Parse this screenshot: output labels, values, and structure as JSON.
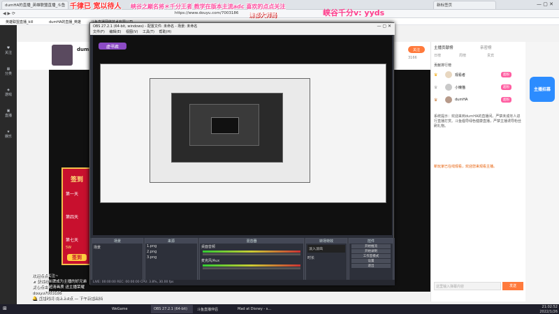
{
  "browser": {
    "tabs": [
      {
        "label": "dumHA的直播_英雄联盟直播_斗鱼"
      },
      {
        "label": "新标签页"
      }
    ],
    "bookmarks": [
      "英雄联盟直播_kill",
      "dumHA的直播_英雄",
      "斗鱼直播网络技术有限公司"
    ],
    "url": "https://www.douyu.com/7003186"
  },
  "overlay": {
    "banner_left": "千律已  宽以待人",
    "banner_mid": "峡谷之巅名将＊千分王者  教学在版本主流adc  喜欢的点点关注",
    "banner_right": "峡谷千分v: yyds",
    "subtitle": "清都大师局"
  },
  "site_nav": [
    "关注",
    "分类",
    "游戏",
    "直播",
    "娱乐"
  ],
  "room": {
    "anchor_name": "dumHA的直播",
    "follow_label": "关注",
    "follow_count": "3166"
  },
  "obs": {
    "title": "OBS 27.2.1 (64-bit, windows) - 配置文件: 未命名 - 场景: 未命名",
    "menu": [
      "文件(F)",
      "编辑(E)",
      "视图(V)",
      "工具(T)",
      "帮助(H)"
    ],
    "docks": [
      {
        "title": "场景",
        "items": [
          "场景"
        ]
      },
      {
        "title": "来源",
        "items": [
          "1.png",
          "2.png",
          "3.png"
        ]
      },
      {
        "title": "混音器",
        "items": [
          "桌面音频",
          "麦克风/Aux"
        ]
      },
      {
        "title": "转场特效",
        "items": [
          "淡入淡出",
          "时长"
        ]
      },
      {
        "title": "控件",
        "items": [
          "开始推流",
          "开始录制",
          "工作室模式",
          "设置",
          "退出"
        ]
      }
    ],
    "status": "LIVE: 00:00:00   REC: 00:00:00   CPU: 3.8%, 30.00 fps",
    "preview_tag": "虚书君"
  },
  "right_panel": {
    "tabs": [
      "主播贡献榜",
      "亲密榜"
    ],
    "sub_tabs": [
      "日榜",
      "周榜",
      "贵宾"
    ],
    "ranking_title": "贡献排行榜",
    "ranking": [
      {
        "name": "观看者",
        "badge": "超粉"
      },
      {
        "name": "小懒猫",
        "badge": "超粉"
      },
      {
        "name": "dumHA",
        "badge": "超粉"
      }
    ],
    "system_msg": "系统提示：欢迎来到dumHA的直播间。严禁未成年人进行直播打赏。斗鱼倡导绿色健康直播，严禁主播诱导粉丝刷礼物。",
    "enter_msg": "新玩家已在线观看，欢迎您来观看主播。",
    "chat_placeholder": "这里输入弹幕内容",
    "send_label": "发送"
  },
  "side_promo": {
    "label": "主播招募"
  },
  "sign_card": {
    "title": "签到",
    "days": [
      "第一天",
      "第四天",
      "第七天"
    ],
    "button": "签到",
    "reward": "5W"
  },
  "live_chat": [
    "欢迎点点关注~",
    "★ 获得粉丝牌成为主播的好兄弟",
    "爱心点击 超清画质 送主播荣耀",
    "douyu7003186",
    "🔔 直播时间 晚上上8点 — 下午新播出档"
  ],
  "taskbar": {
    "items": [
      "WeGame",
      "OBS 27.2.1 (64-bit)",
      "斗鱼直播伴侣",
      "Mad at Disney - s..."
    ],
    "time": "21:02:52",
    "date": "2022/1/26"
  }
}
